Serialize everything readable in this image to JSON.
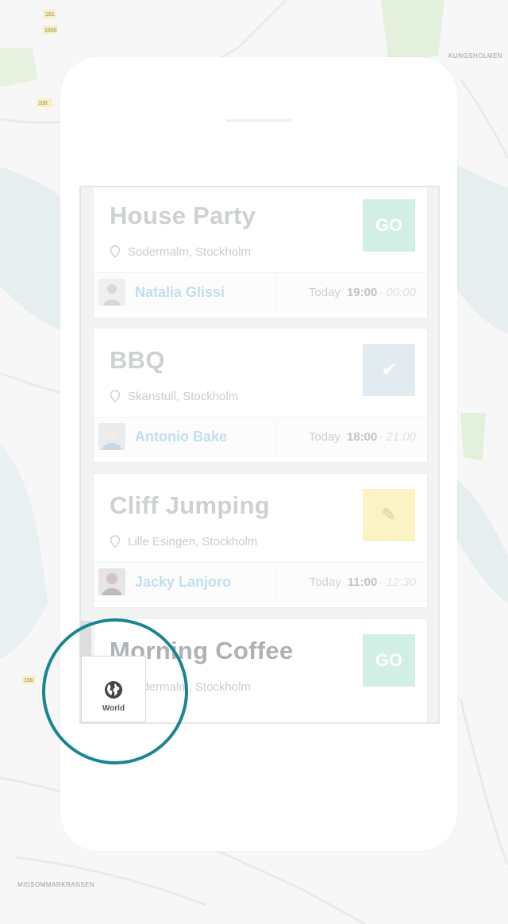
{
  "map": {
    "labels": [
      "KUNGSHOLMEN",
      "MIDSOMMARKRANSEN"
    ],
    "route_markers": [
      "161",
      "1600",
      "100",
      "156"
    ]
  },
  "events": [
    {
      "title": "House Party",
      "location": "Sodermalm, Stockholm",
      "action": "GO",
      "action_type": "go",
      "person": "Natalia Glissi",
      "day": "Today",
      "start": "19:00",
      "end": "- 00:00"
    },
    {
      "title": "BBQ",
      "location": "Skanstull, Stockholm",
      "action": "✔",
      "action_type": "check",
      "person": "Antonio Bake",
      "day": "Today",
      "start": "18:00",
      "end": "- 21:00"
    },
    {
      "title": "Cliff Jumping",
      "location": "Lille Esingen, Stockholm",
      "action": "✎",
      "action_type": "edit",
      "person": "Jacky Lanjoro",
      "day": "Today",
      "start": "11:00",
      "end": "- 12:30"
    },
    {
      "title": "Morning Coffee",
      "location": "Sodermalm, Stockholm",
      "action": "GO",
      "action_type": "go",
      "person": "",
      "day": "",
      "start": "",
      "end": ""
    }
  ],
  "world_tab": {
    "label": "World",
    "icon": "globe-icon"
  },
  "colors": {
    "highlight_ring": "#1a8592",
    "go": "#d2efe4",
    "check": "#e2ecf0",
    "edit": "#fbf3c4"
  }
}
